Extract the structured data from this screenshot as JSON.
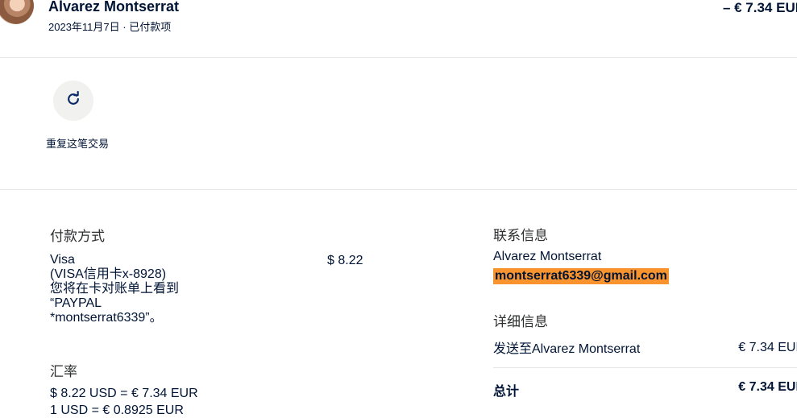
{
  "transaction": {
    "counterparty_name": "Alvarez Montserrat",
    "date_status": "2023年11月7日 · 已付款项",
    "amount": "– € 7.34 EUR"
  },
  "actions": {
    "repeat_label": "重复这笔交易",
    "repeat_icon": "refresh-icon"
  },
  "payment_method": {
    "title": "付款方式",
    "lines": "Visa\n(VISA信用卡x-8928)\n您将在卡对账单上看到\n“PAYPAL\n*montserrat6339”。",
    "amount": "$ 8.22"
  },
  "exchange_rate": {
    "title": "汇率",
    "line1": "$ 8.22 USD = € 7.34 EUR",
    "line2": "1 USD = € 0.8925 EUR"
  },
  "contact": {
    "title": "联系信息",
    "name": "Alvarez Montserrat",
    "email": "montserrat6339@gmail.com"
  },
  "details": {
    "title": "详细信息",
    "sent_to_label": "发送至Alvarez Montserrat",
    "sent_to_amount": "€ 7.34 EUR",
    "total_label": "总计",
    "total_amount": "€ 7.34 EUR"
  },
  "colors": {
    "email_highlight": "#f9932d",
    "text": "#001435"
  }
}
